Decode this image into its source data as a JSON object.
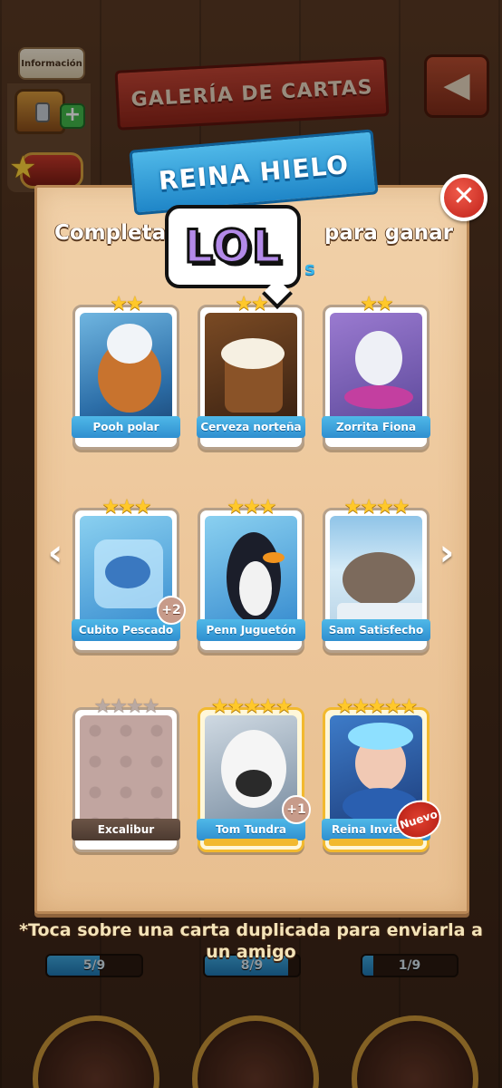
{
  "header": {
    "info_label": "Información",
    "gallery_title": "GALERÍA DE CARTAS",
    "back_icon": "back-arrow-icon"
  },
  "set": {
    "name": "REINA HIELO",
    "instruction": [
      "Completa",
      "para ganar"
    ],
    "instruction_line2": "s",
    "overlay_text": "LOL"
  },
  "cards": [
    {
      "name": "Pooh polar",
      "stars": 2,
      "rarity": "normal",
      "badge": "",
      "locked": false
    },
    {
      "name": "Cerveza norteña",
      "stars": 2,
      "rarity": "normal",
      "badge": "",
      "locked": false
    },
    {
      "name": "Zorrita Fiona",
      "stars": 2,
      "rarity": "normal",
      "badge": "",
      "locked": false
    },
    {
      "name": "Cubito Pescado",
      "stars": 3,
      "rarity": "normal",
      "badge": "+2",
      "locked": false
    },
    {
      "name": "Penn Juguetón",
      "stars": 3,
      "rarity": "normal",
      "badge": "",
      "locked": false
    },
    {
      "name": "Sam Satisfecho",
      "stars": 4,
      "rarity": "normal",
      "badge": "",
      "locked": false
    },
    {
      "name": "Excalibur",
      "stars": 4,
      "rarity": "normal",
      "badge": "",
      "locked": true
    },
    {
      "name": "Tom Tundra",
      "stars": 5,
      "rarity": "gold",
      "badge": "+1",
      "locked": false
    },
    {
      "name": "Reina Invierno",
      "stars": 5,
      "rarity": "gold",
      "badge": "Nuevo",
      "locked": false
    }
  ],
  "footer": {
    "note": "*Toca sobre una carta duplicada para enviarla a un amigo",
    "progress": [
      {
        "text": "5/9",
        "fraction": 0.556
      },
      {
        "text": "8/9",
        "fraction": 0.889
      },
      {
        "text": "1/9",
        "fraction": 0.111
      }
    ]
  },
  "colors": {
    "panel": "#edc79b",
    "blue_banner": "#1f86c8",
    "red_banner": "#8e2419",
    "gold": "#f2b92e"
  }
}
